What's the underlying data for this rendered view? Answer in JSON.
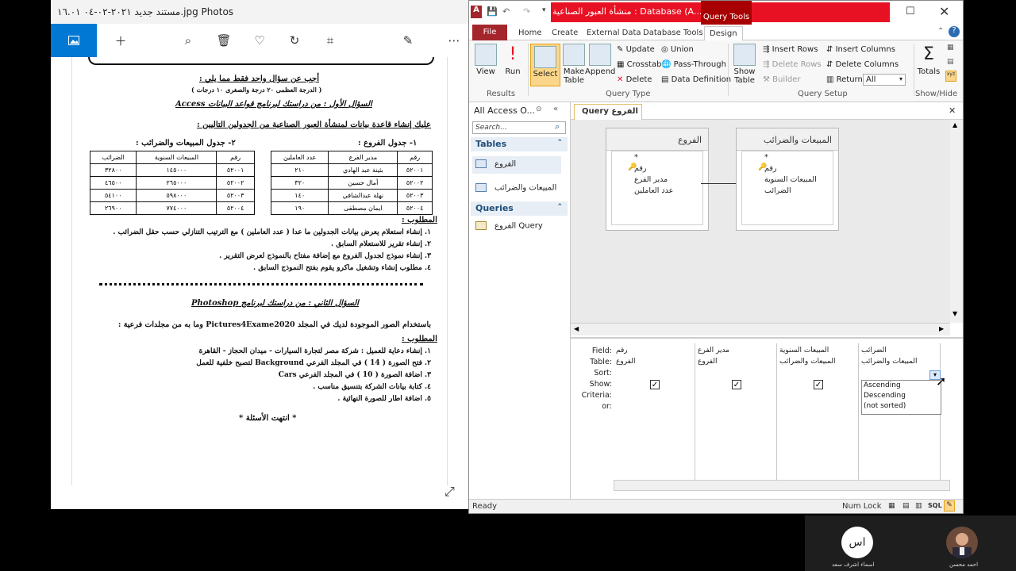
{
  "photos": {
    "title": "مستند جديد ٢٠٢١-٠٢-٠٤ ١٦.٠١.jpg Photos",
    "document": {
      "header_line": "أجب عن سؤال واحد فقط مما يلي :",
      "header_sub": "( الدرجة العظمى ٢٠ درجة والصغرى ١٠ درجات )",
      "q1_title": "السؤال الأول : من دراستك لبرنامج قواعد البيانات Access",
      "q1_intro": "عليك إنشاء قاعدة بيانات لمنشأة العبور الصناعية من الجدولين التاليين :",
      "t1_title": "١- جدول الفروع :",
      "t2_title": "٢- جدول المبيعات والضرائب :",
      "t1_headers": [
        "رقم",
        "مدير الفرع",
        "عدد العاملين"
      ],
      "t1_rows": [
        [
          "٥٢٠٠١",
          "بثينة عبد الهادي",
          "٢١٠"
        ],
        [
          "٥٢٠٠٢",
          "أمال حسين",
          "٣٢٠"
        ],
        [
          "٥٢٠٠٣",
          "نهلة عبدالشافي",
          "١٤٠"
        ],
        [
          "٥٢٠٠٤",
          "ايمان مصطفى",
          "١٩٠"
        ]
      ],
      "t2_headers": [
        "رقم",
        "المبيعات السنوية",
        "الضرائب"
      ],
      "t2_rows": [
        [
          "٥٢٠٠١",
          "١٤٥٠٠٠",
          "٣٢٨٠٠"
        ],
        [
          "٥٢٠٠٢",
          "٢٦٥٠٠٠",
          "٤٦٥٠٠"
        ],
        [
          "٥٢٠٠٣",
          "٥٩٨٠٠٠",
          "٥٤١٠٠"
        ],
        [
          "٥٢٠٠٤",
          "٧٧٤٠٠٠",
          "٢٦٩٠٠"
        ]
      ],
      "req1_title": "المطلوب :",
      "req1": [
        "١. إنشاء استعلام يعرض بيانات الجدولين ما عدا ( عدد العاملين ) مع الترتيب التنازلي حسب حقل الضرائب .",
        "٢. إنشاء تقرير للاستعلام السابق .",
        "٣. إنشاء نموذج لجدول الفروع مع إضافة مفتاح بالنموذج لعرض التقرير .",
        "٤. مطلوب إنشاء وتشغيل ماكرو يقوم بفتح النموذج السابق ."
      ],
      "q2_title": "السؤال الثاني : من دراستك لبرنامج Photoshop",
      "q2_intro": "باستخدام الصور الموجودة لديك في المجلد Pictures4Exame2020 وما به من مجلدات فرعية :",
      "req2_title": "المطلوب :",
      "req2": [
        "١. إنشاء دعاية للعميل : شركة مصر لتجارة السيارات - ميدان الحجاز - القاهرة",
        "٢. فتح الصورة ( 14 ) في المجلد الفرعي Background لتصبح خلفية للعمل",
        "٣. اضافة الصورة ( 10 ) في المجلد الفرعي Cars",
        "٤. كتابة بيانات الشركة بتنسيق مناسب .",
        "٥. اضافة اطار للصورة النهائية ."
      ],
      "end": "* انتهت الأسئلة *"
    }
  },
  "access": {
    "title": "منشأة العبور الصناعية : Database (A...",
    "query_tools": "Query Tools",
    "tabs": [
      "File",
      "Home",
      "Create",
      "External Data",
      "Database Tools",
      "Design"
    ],
    "ribbon": {
      "results": {
        "label": "Results",
        "view": "View",
        "run": "Run"
      },
      "query_type": {
        "label": "Query Type",
        "select": "Select",
        "make_table": "Make Table",
        "append": "Append",
        "update": "Update",
        "crosstab": "Crosstab",
        "delete": "Delete",
        "union": "Union",
        "pass_through": "Pass-Through",
        "data_definition": "Data Definition"
      },
      "query_setup": {
        "label": "Query Setup",
        "show_table": "Show Table",
        "insert_rows": "Insert Rows",
        "delete_rows": "Delete Rows",
        "builder": "Builder",
        "insert_columns": "Insert Columns",
        "delete_columns": "Delete Columns",
        "return_label": "Return:",
        "return_value": "All"
      },
      "show_hide": {
        "label": "Show/Hide",
        "totals": "Totals"
      }
    },
    "nav": {
      "header": "All Access O...",
      "search_placeholder": "Search...",
      "tables_label": "Tables",
      "tables": [
        "الفروع",
        "المبيعات والضرائب"
      ],
      "queries_label": "Queries",
      "queries": [
        "الفروع Query"
      ]
    },
    "query_tab": "الفروع Query",
    "tables": [
      {
        "name": "الفروع",
        "fields": [
          "*",
          "رقم",
          "مدير الفرع",
          "عدد العاملين"
        ]
      },
      {
        "name": "المبيعات والضرائب",
        "fields": [
          "*",
          "رقم",
          "المبيعات السنوية",
          "الضرائب"
        ]
      }
    ],
    "grid": {
      "row_labels": [
        "Field:",
        "Table:",
        "Sort:",
        "Show:",
        "Criteria:",
        "or:"
      ],
      "columns": [
        {
          "field": "رقم",
          "table": "الفروع",
          "show": true
        },
        {
          "field": "مدير الفرع",
          "table": "الفروع",
          "show": true
        },
        {
          "field": "المبيعات السنوية",
          "table": "المبيعات والضرائب",
          "show": true
        },
        {
          "field": "الضرائب",
          "table": "المبيعات والضرائب",
          "show": false
        }
      ],
      "sort_options": [
        "Ascending",
        "Descending",
        "(not sorted)"
      ]
    },
    "status": {
      "ready": "Ready",
      "num_lock": "Num Lock",
      "sql": "SQL"
    }
  },
  "participants": [
    {
      "initials": "اس",
      "name": "اسماء اشرف سعد"
    },
    {
      "initials": "",
      "name": "احمد محسن"
    }
  ]
}
